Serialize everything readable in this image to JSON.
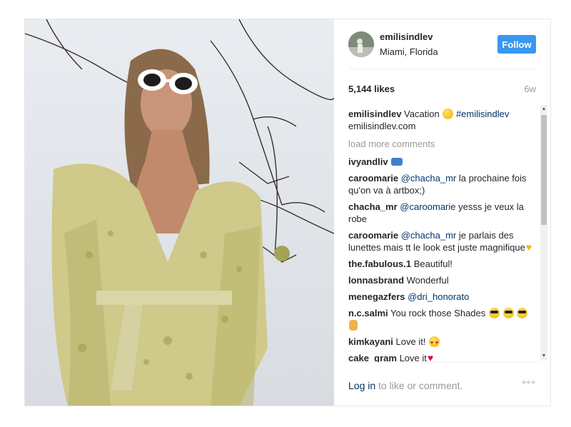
{
  "header": {
    "username": "emilisindlev",
    "location": "Miami, Florida",
    "follow_label": "Follow"
  },
  "stats": {
    "likes": "5,144 likes",
    "age": "6w"
  },
  "caption": {
    "username": "emilisindlev",
    "text": "Vacation",
    "hashtag": "#emilisindlev",
    "link": "emilisindlev.com"
  },
  "load_more": "load more comments",
  "comments": [
    {
      "user": "ivyandliv",
      "mention": "",
      "text": ""
    },
    {
      "user": "caroomarie",
      "mention": "@chacha_mr",
      "text": "la prochaine fois qu'on va à artbox;)"
    },
    {
      "user": "chacha_mr",
      "mention": "@caroomarie",
      "text": "yesss je veux la robe"
    },
    {
      "user": "caroomarie",
      "mention": "@chacha_mr",
      "text": "je parlais des lunettes mais tt le look est juste magnifique"
    },
    {
      "user": "the.fabulous.1",
      "mention": "",
      "text": "Beautiful!"
    },
    {
      "user": "lonnasbrand",
      "mention": "",
      "text": "Wonderful"
    },
    {
      "user": "menegazfers",
      "mention": "@dri_honorato",
      "text": ""
    },
    {
      "user": "n.c.salmi",
      "mention": "",
      "text": "You rock those Shades"
    },
    {
      "user": "kimkayani",
      "mention": "",
      "text": "Love it!"
    },
    {
      "user": "cake_gram",
      "mention": "",
      "text": "Love it"
    }
  ],
  "footer": {
    "login_link": "Log in",
    "login_rest": "to like or comment.",
    "more": "°°°"
  },
  "icons": {
    "more": "more-options-icon",
    "scroll_up": "scroll-up-arrow-icon",
    "scroll_down": "scroll-down-arrow-icon"
  },
  "colors": {
    "follow_bg": "#3897f0",
    "mention": "#003569",
    "muted": "#999999"
  }
}
